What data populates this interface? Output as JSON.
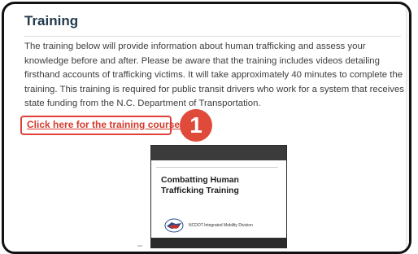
{
  "section": {
    "title": "Training",
    "description": "The training below will provide information about human trafficking and assess your knowledge before and after. Please be aware that the training includes videos detailing firsthand accounts of trafficking victims. It will take approximately 40 minutes to complete the training. This training is required for public transit drivers who work for a system that receives state funding from the N.C. Department of Transportation.",
    "link_label": "Click here for the training course."
  },
  "callout": {
    "step_number": "1"
  },
  "video": {
    "title": "Combatting Human Trafficking Training",
    "organization": "NCDOT Integrated Mobility Division",
    "logo_icon": "ncdot-logo-icon"
  },
  "colors": {
    "heading": "#243a4f",
    "link": "#d33a2c",
    "highlight_border": "#e0403a",
    "badge": "#e04a3b",
    "text": "#3d3d3d"
  }
}
